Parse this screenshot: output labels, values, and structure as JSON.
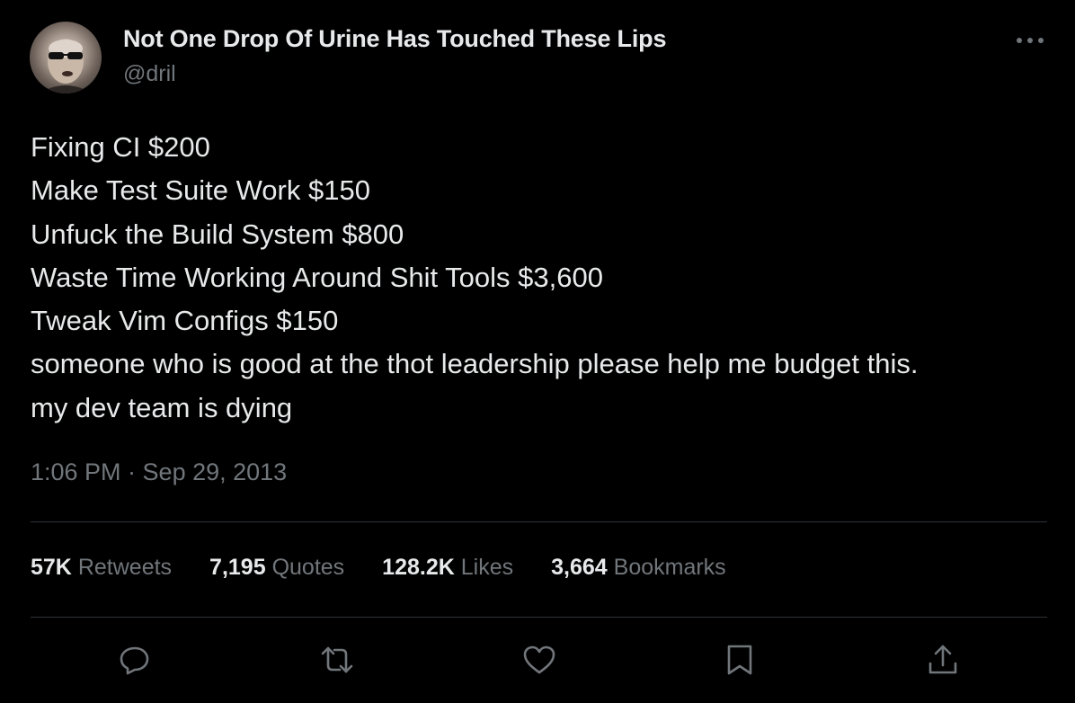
{
  "author": {
    "display_name": "Not One Drop Of Urine Has Touched These Lips",
    "handle": "@dril"
  },
  "tweet": {
    "lines": [
      "Fixing CI $200",
      "Make Test Suite Work $150",
      "Unfuck the Build System $800",
      "Waste Time Working Around Shit Tools $3,600",
      "Tweak Vim Configs $150",
      "someone who is good at the thot leadership please help me budget this.",
      "my dev team is dying"
    ],
    "timestamp": "1:06 PM · Sep 29, 2013"
  },
  "stats": {
    "retweets": {
      "count": "57K",
      "label": "Retweets"
    },
    "quotes": {
      "count": "7,195",
      "label": "Quotes"
    },
    "likes": {
      "count": "128.2K",
      "label": "Likes"
    },
    "bookmarks": {
      "count": "3,664",
      "label": "Bookmarks"
    }
  },
  "actions": [
    "reply-icon",
    "retweet-icon",
    "like-icon",
    "bookmark-icon",
    "share-icon"
  ],
  "colors": {
    "background": "#000000",
    "primary_text": "#e7e9ea",
    "secondary_text": "#71767b",
    "divider": "#2f3336"
  }
}
